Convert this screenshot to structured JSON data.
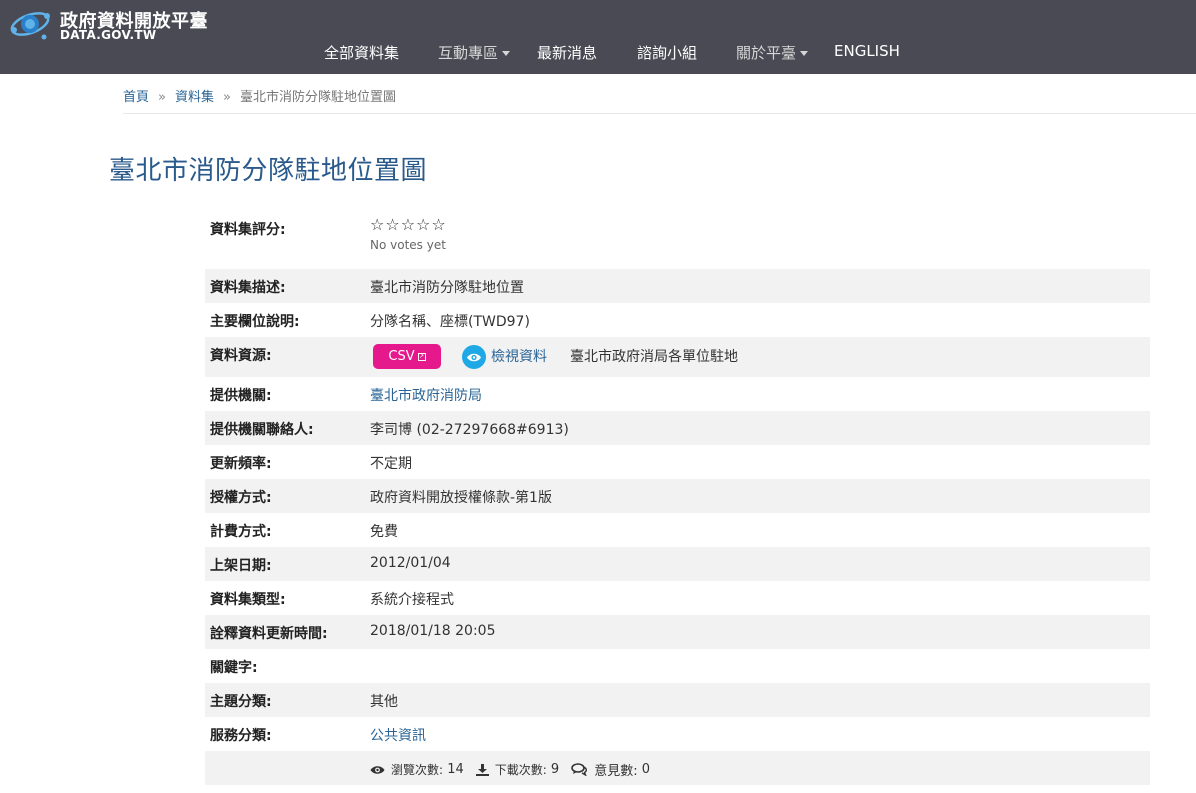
{
  "header": {
    "logo_title": "政府資料開放平臺",
    "logo_sub": "DATA.GOV.TW",
    "nav": [
      {
        "label": "全部資料集"
      },
      {
        "label": "互動專區"
      },
      {
        "label": "最新消息"
      },
      {
        "label": "諮詢小組"
      },
      {
        "label": "關於平臺"
      },
      {
        "label": "ENGLISH"
      }
    ]
  },
  "breadcrumb": {
    "home": "首頁",
    "datasets": "資料集",
    "current": "臺北市消防分隊駐地位置圖",
    "separator": "»"
  },
  "page": {
    "title": "臺北市消防分隊駐地位置圖"
  },
  "fields": {
    "rating": {
      "label": "資料集評分:",
      "stars": "☆☆☆☆☆",
      "votes": "No votes yet"
    },
    "description": {
      "label": "資料集描述:",
      "value": "臺北市消防分隊駐地位置"
    },
    "main_fields": {
      "label": "主要欄位說明:",
      "value": "分隊名稱、座標(TWD97)"
    },
    "resource": {
      "label": "資料資源:",
      "format": "CSV",
      "view_label": "檢視資料",
      "source": "臺北市政府消局各單位駐地"
    },
    "provider": {
      "label": "提供機關:",
      "value": "臺北市政府消防局"
    },
    "contact": {
      "label": "提供機關聯絡人:",
      "value": "李司博 (02-27297668#6913)"
    },
    "frequency": {
      "label": "更新頻率:",
      "value": "不定期"
    },
    "license": {
      "label": "授權方式:",
      "value": "政府資料開放授權條款-第1版"
    },
    "fee": {
      "label": "計費方式:",
      "value": "免費"
    },
    "published": {
      "label": "上架日期:",
      "value": "2012/01/04"
    },
    "type": {
      "label": "資料集類型:",
      "value": "系統介接程式"
    },
    "meta_updated": {
      "label": "詮釋資料更新時間:",
      "value": "2018/01/18 20:05"
    },
    "keywords": {
      "label": "關鍵字:",
      "value": ""
    },
    "category": {
      "label": "主題分類:",
      "value": "其他"
    },
    "service": {
      "label": "服務分類:",
      "value": "公共資訊"
    }
  },
  "stats": {
    "views_label": "瀏覽次數:",
    "views": "14",
    "downloads_label": "下載次數:",
    "downloads": "9",
    "comments_label": "意見數:",
    "comments": "0"
  },
  "colors": {
    "header_bg": "#4a4a54",
    "csv_badge": "#e5198c",
    "view_icon": "#1ea8e6",
    "link": "#2a6496",
    "title": "#2a5a8c"
  }
}
